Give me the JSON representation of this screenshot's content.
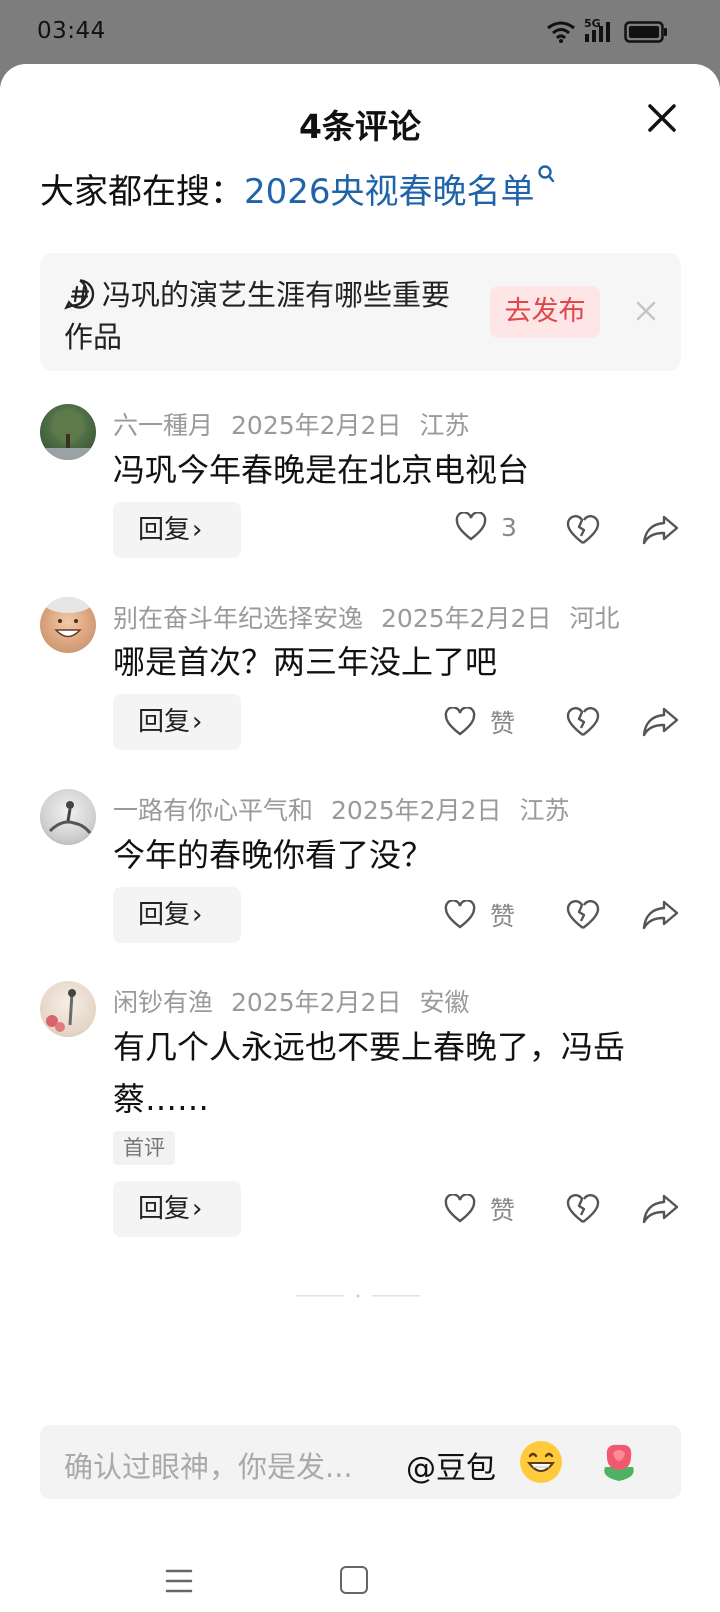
{
  "status_bar": {
    "time": "03:44",
    "network": "5G"
  },
  "header": {
    "title": "4条评论"
  },
  "search_hint": {
    "prefix": "大家都在搜：",
    "query": "2026央视春晚名单"
  },
  "topic_card": {
    "text": "冯巩的演艺生涯有哪些重要作品",
    "publish_label": "去发布"
  },
  "comments": [
    {
      "user": "六一種月",
      "date": "2025年2月2日",
      "location": "江苏",
      "text": "冯巩今年春晚是在北京电视台",
      "badge": "",
      "reply_label": "回复",
      "likes": "3"
    },
    {
      "user": "别在奋斗年纪选择安逸",
      "date": "2025年2月2日",
      "location": "河北",
      "text": "哪是首次？两三年没上了吧",
      "badge": "",
      "reply_label": "回复",
      "likes": "赞"
    },
    {
      "user": "一路有你心平气和",
      "date": "2025年2月2日",
      "location": "江苏",
      "text": "今年的春晚你看了没？",
      "badge": "",
      "reply_label": "回复",
      "likes": "赞"
    },
    {
      "user": "闲钞有渔",
      "date": "2025年2月2日",
      "location": "安徽",
      "text": "有几个人永远也不要上春晚了，冯岳蔡……",
      "badge": "首评",
      "reply_label": "回复",
      "likes": "赞"
    }
  ],
  "input_bar": {
    "placeholder": "确认过眼神，你是发...",
    "mention": "@豆包",
    "emoji_icon": "grin-emoji-icon",
    "gift_icon": "flower-icon"
  },
  "colors": {
    "link": "#1f64a8",
    "publish_bg": "#fde6e5",
    "publish_text": "#e0464a"
  }
}
